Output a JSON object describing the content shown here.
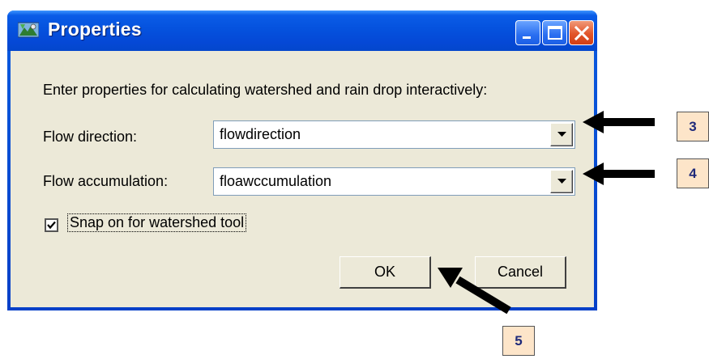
{
  "window": {
    "title": "Properties"
  },
  "dialog": {
    "prompt": "Enter properties for calculating watershed and rain drop interactively:",
    "flow_direction": {
      "label": "Flow direction:",
      "value": "flowdirection"
    },
    "flow_accumulation": {
      "label": "Flow accumulation:",
      "value": "floawccumulation"
    },
    "snap_checkbox": {
      "label": "Snap on for watershed tool",
      "checked": true
    },
    "ok_label": "OK",
    "cancel_label": "Cancel"
  },
  "callouts": [
    "3",
    "4",
    "5"
  ],
  "colors": {
    "titlebar": "#0552de",
    "client": "#ece9d8",
    "callout_fill": "#fde5c9",
    "callout_text": "#1f2a7a"
  }
}
